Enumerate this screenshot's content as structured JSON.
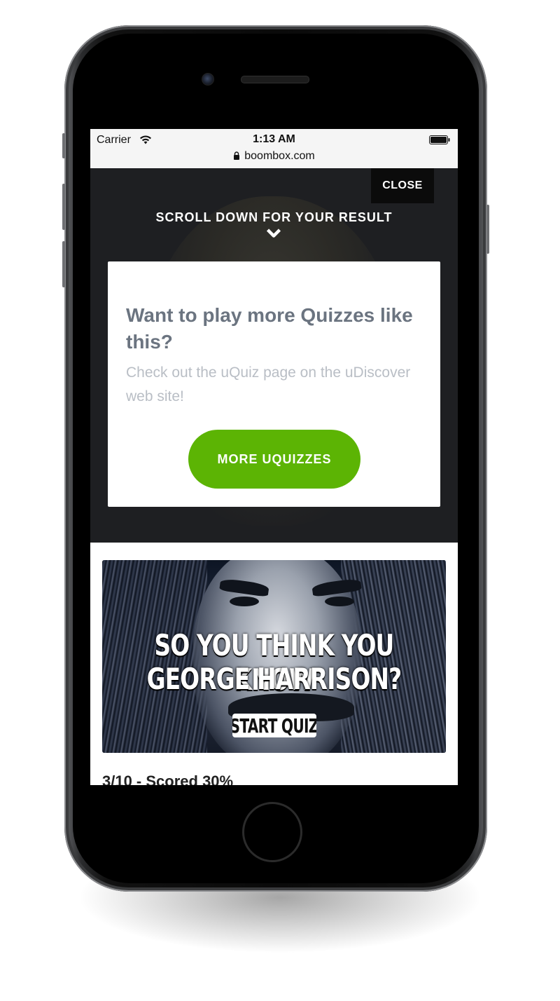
{
  "status_bar": {
    "carrier": "Carrier",
    "time": "1:13 AM",
    "url": "boombox.com"
  },
  "hero": {
    "close_label": "CLOSE",
    "scroll_hint": "SCROLL DOWN FOR YOUR RESULT"
  },
  "promo": {
    "title": "Want to play more Quizzes like this?",
    "text": "Check out the uQuiz page on the uDiscover web site!",
    "button_label": "MORE UQUIZZES",
    "button_color": "#5cb404"
  },
  "quiz_banner": {
    "line1": "SO YOU THINK YOU KNOW",
    "line2": "GEORGE HARRISON?",
    "start_label": "START QUIZ"
  },
  "result": {
    "score": "3/10 - Scored 30%"
  },
  "colors": {
    "hero_background": "#1e1f22",
    "promo_title": "#6b7480",
    "promo_text": "#b9bec5"
  }
}
